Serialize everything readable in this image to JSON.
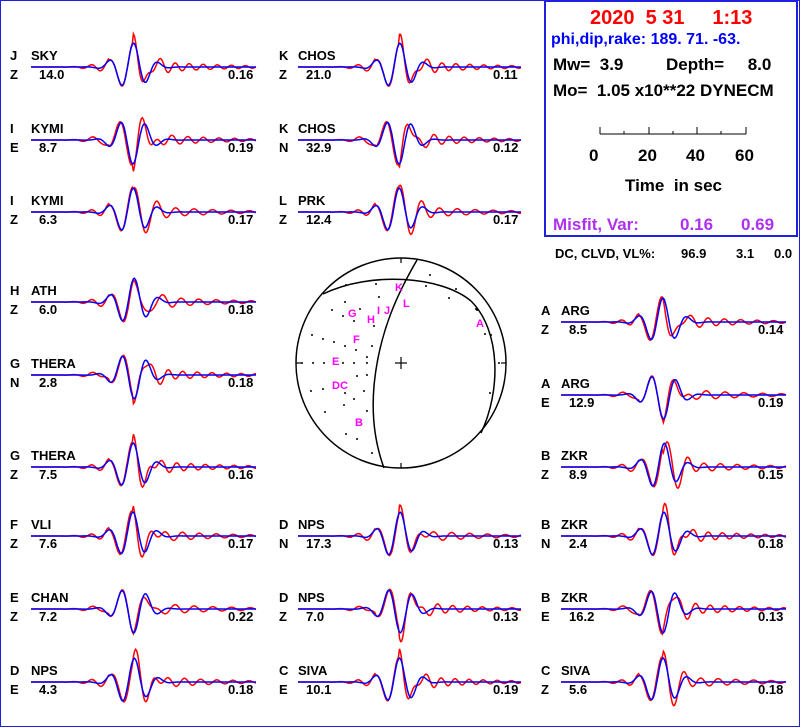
{
  "header": {
    "date": "2020  5 31     1:13",
    "angles": "phi,dip,rake: 189. 71.  -63.",
    "mw_label": "Mw=  3.9",
    "depth_label": "Depth=     8.0",
    "mo_label": "Mo=  1.05 x10**22 DYNECM",
    "time_ticks": [
      "0",
      "20",
      "40",
      "60"
    ],
    "time_label": "Time  in sec",
    "misfit_label": "Misfit, Var:",
    "misfit": "0.16",
    "var": "0.69",
    "dc_label": "DC, CLVD, VL%:",
    "dc": "96.9",
    "clvd": "3.1",
    "vl": "0.0"
  },
  "colors": {
    "observed": "#ff0000",
    "synthetic": "#0000ff",
    "polarity": "#ff00ff",
    "frame": "#2020e0",
    "misfit": "#b030f0"
  },
  "beachball_labels": [
    "K",
    "L",
    "I",
    "J",
    "H",
    "G",
    "F",
    "E",
    "DC",
    "B",
    "A"
  ],
  "traces": [
    {
      "letter": "J",
      "station": "SKY",
      "comp": "Z",
      "dist": "14.0",
      "var": "0.16"
    },
    {
      "letter": "I",
      "station": "KYMI",
      "comp": "E",
      "dist": "8.7",
      "var": "0.19"
    },
    {
      "letter": "I",
      "station": "KYMI",
      "comp": "Z",
      "dist": "6.3",
      "var": "0.17"
    },
    {
      "letter": "H",
      "station": "ATH",
      "comp": "Z",
      "dist": "6.0",
      "var": "0.18"
    },
    {
      "letter": "G",
      "station": "THERA",
      "comp": "N",
      "dist": "2.8",
      "var": "0.18"
    },
    {
      "letter": "G",
      "station": "THERA",
      "comp": "Z",
      "dist": "7.5",
      "var": "0.16"
    },
    {
      "letter": "F",
      "station": "VLI",
      "comp": "Z",
      "dist": "7.6",
      "var": "0.17"
    },
    {
      "letter": "E",
      "station": "CHAN",
      "comp": "Z",
      "dist": "7.2",
      "var": "0.22"
    },
    {
      "letter": "D",
      "station": "NPS",
      "comp": "E",
      "dist": "4.3",
      "var": "0.18"
    },
    {
      "letter": "K",
      "station": "CHOS",
      "comp": "Z",
      "dist": "21.0",
      "var": "0.11"
    },
    {
      "letter": "K",
      "station": "CHOS",
      "comp": "N",
      "dist": "32.9",
      "var": "0.12"
    },
    {
      "letter": "L",
      "station": "PRK",
      "comp": "Z",
      "dist": "12.4",
      "var": "0.17"
    },
    {
      "letter": "D",
      "station": "NPS",
      "comp": "N",
      "dist": "17.3",
      "var": "0.13"
    },
    {
      "letter": "D",
      "station": "NPS",
      "comp": "Z",
      "dist": "7.0",
      "var": "0.13"
    },
    {
      "letter": "C",
      "station": "SIVA",
      "comp": "E",
      "dist": "10.1",
      "var": "0.19"
    },
    {
      "letter": "A",
      "station": "ARG",
      "comp": "Z",
      "dist": "8.5",
      "var": "0.14"
    },
    {
      "letter": "A",
      "station": "ARG",
      "comp": "E",
      "dist": "12.9",
      "var": "0.19"
    },
    {
      "letter": "B",
      "station": "ZKR",
      "comp": "Z",
      "dist": "8.9",
      "var": "0.15"
    },
    {
      "letter": "B",
      "station": "ZKR",
      "comp": "N",
      "dist": "2.4",
      "var": "0.18"
    },
    {
      "letter": "B",
      "station": "ZKR",
      "comp": "E",
      "dist": "16.2",
      "var": "0.13"
    },
    {
      "letter": "C",
      "station": "SIVA",
      "comp": "Z",
      "dist": "5.6",
      "var": "0.18"
    }
  ]
}
